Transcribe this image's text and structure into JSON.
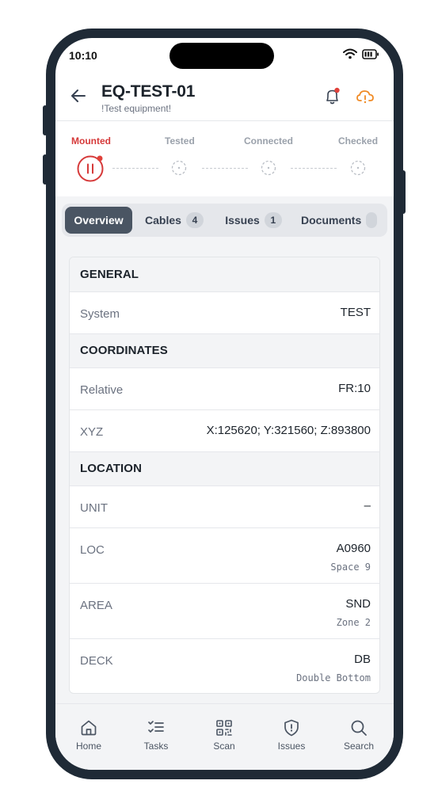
{
  "status_bar": {
    "time": "10:10"
  },
  "header": {
    "title": "EQ-TEST-01",
    "subtitle": "!Test equipment!"
  },
  "steps": [
    {
      "label": "Mounted",
      "active": true
    },
    {
      "label": "Tested",
      "active": false
    },
    {
      "label": "Connected",
      "active": false
    },
    {
      "label": "Checked",
      "active": false
    }
  ],
  "tabs": [
    {
      "label": "Overview",
      "badge": ""
    },
    {
      "label": "Cables",
      "badge": "4"
    },
    {
      "label": "Issues",
      "badge": "1"
    },
    {
      "label": "Documents",
      "badge": ""
    }
  ],
  "sections": {
    "general": {
      "title": "GENERAL",
      "system": {
        "label": "System",
        "value": "TEST"
      }
    },
    "coordinates": {
      "title": "COORDINATES",
      "relative": {
        "label": "Relative",
        "value": "FR:10"
      },
      "xyz": {
        "label": "XYZ",
        "value": "X:125620; Y:321560; Z:893800"
      }
    },
    "location": {
      "title": "LOCATION",
      "unit": {
        "label": "UNIT",
        "value": "–"
      },
      "loc": {
        "label": "LOC",
        "value": "A0960",
        "sub": "Space 9"
      },
      "area": {
        "label": "AREA",
        "value": "SND",
        "sub": "Zone 2"
      },
      "deck": {
        "label": "DECK",
        "value": "DB",
        "sub": "Double Bottom"
      }
    }
  },
  "bottom_nav": [
    {
      "label": "Home",
      "icon": "home-icon"
    },
    {
      "label": "Tasks",
      "icon": "tasks-icon"
    },
    {
      "label": "Scan",
      "icon": "qr-scan-icon"
    },
    {
      "label": "Issues",
      "icon": "shield-alert-icon"
    },
    {
      "label": "Search",
      "icon": "search-icon"
    }
  ],
  "colors": {
    "accent_red": "#d63a3a",
    "accent_orange": "#f08a24",
    "tab_active": "#4a5563",
    "frame": "#1f2a36"
  }
}
